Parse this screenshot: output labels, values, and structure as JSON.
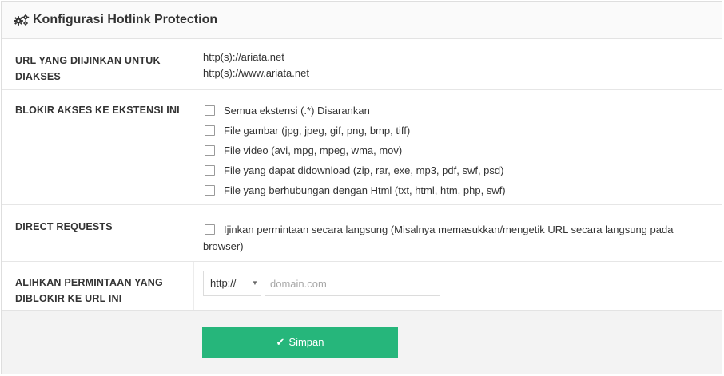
{
  "panel": {
    "title": "Konfigurasi Hotlink Protection",
    "title_icon": "gears-icon"
  },
  "allowed_urls": {
    "label": "URL YANG DIIJINKAN UNTUK DIAKSES",
    "values": [
      "http(s)://ariata.net",
      "http(s)://www.ariata.net"
    ]
  },
  "block_extensions": {
    "label": "BLOKIR AKSES KE EKSTENSI INI",
    "options": [
      {
        "label": "Semua ekstensi (.*) Disarankan",
        "checked": false
      },
      {
        "label": "File gambar (jpg, jpeg, gif, png, bmp, tiff)",
        "checked": false
      },
      {
        "label": "File video (avi, mpg, mpeg, wma, mov)",
        "checked": false
      },
      {
        "label": "File yang dapat didownload (zip, rar, exe, mp3, pdf, swf, psd)",
        "checked": false
      },
      {
        "label": "File yang berhubungan dengan Html (txt, html, htm, php, swf)",
        "checked": false
      }
    ]
  },
  "direct_requests": {
    "label": "DIRECT REQUESTS",
    "option_line1": "Ijinkan permintaan secara langsung (Misalnya memasukkan/mengetik URL secara langsung pada",
    "option_line2": "browser)",
    "checked": false
  },
  "redirect": {
    "label": "ALIHKAN PERMINTAAN YANG DIBLOKIR KE URL INI",
    "protocol_value": "http://",
    "domain_value": "",
    "domain_placeholder": "domain.com"
  },
  "footer": {
    "save_label": "Simpan",
    "save_color": "#26b67b"
  }
}
